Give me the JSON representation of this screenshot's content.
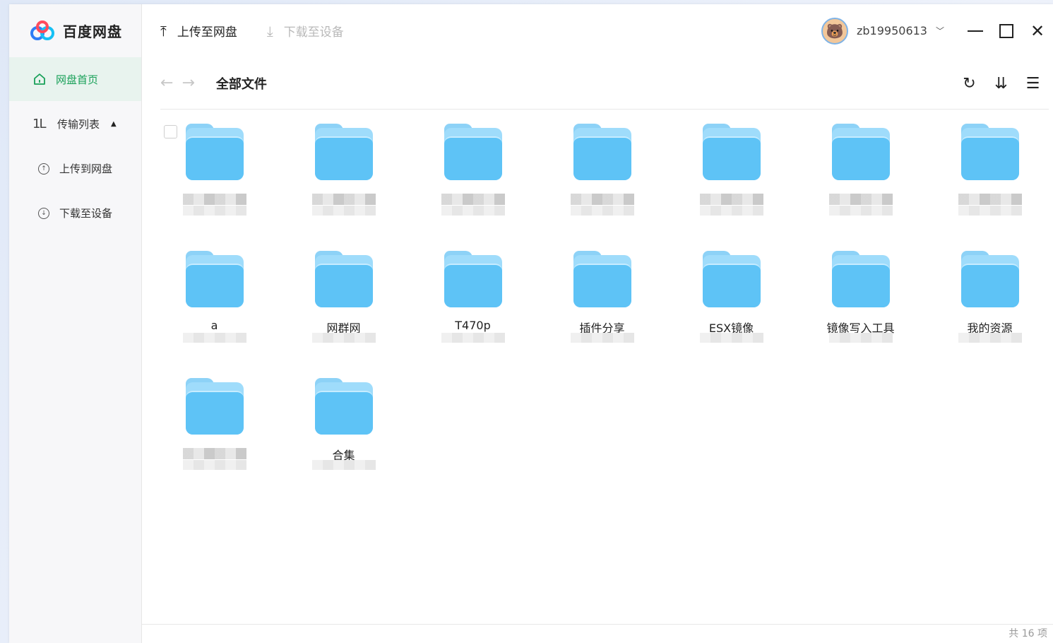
{
  "brand": {
    "name": "百度网盘",
    "logo_icon": "baidu-cloud-logo"
  },
  "sidebar": {
    "home_label": "网盘首页",
    "transfer_label": "传输列表",
    "transfer_expanded": true,
    "sub_items": [
      {
        "label": "上传到网盘",
        "icon": "upload-circle-icon"
      },
      {
        "label": "下载至设备",
        "icon": "download-circle-icon"
      }
    ]
  },
  "toolbar": {
    "upload_label": "上传至网盘",
    "download_label": "下载至设备"
  },
  "user": {
    "name": "zb19950613"
  },
  "path": {
    "title": "全部文件"
  },
  "folders": [
    {
      "name": ""
    },
    {
      "name": ""
    },
    {
      "name": ""
    },
    {
      "name": ""
    },
    {
      "name": ""
    },
    {
      "name": ""
    },
    {
      "name": ""
    },
    {
      "name": "a"
    },
    {
      "name": "网群网"
    },
    {
      "name": "T470p"
    },
    {
      "name": "插件分享"
    },
    {
      "name": "ESX镜像"
    },
    {
      "name": "镜像写入工具"
    },
    {
      "name": "我的资源"
    },
    {
      "name": ""
    },
    {
      "name": "合集"
    }
  ],
  "footer": {
    "count_text": "共 16 项"
  },
  "colors": {
    "accent": "#18a058",
    "folder": "#5ec3f6"
  }
}
